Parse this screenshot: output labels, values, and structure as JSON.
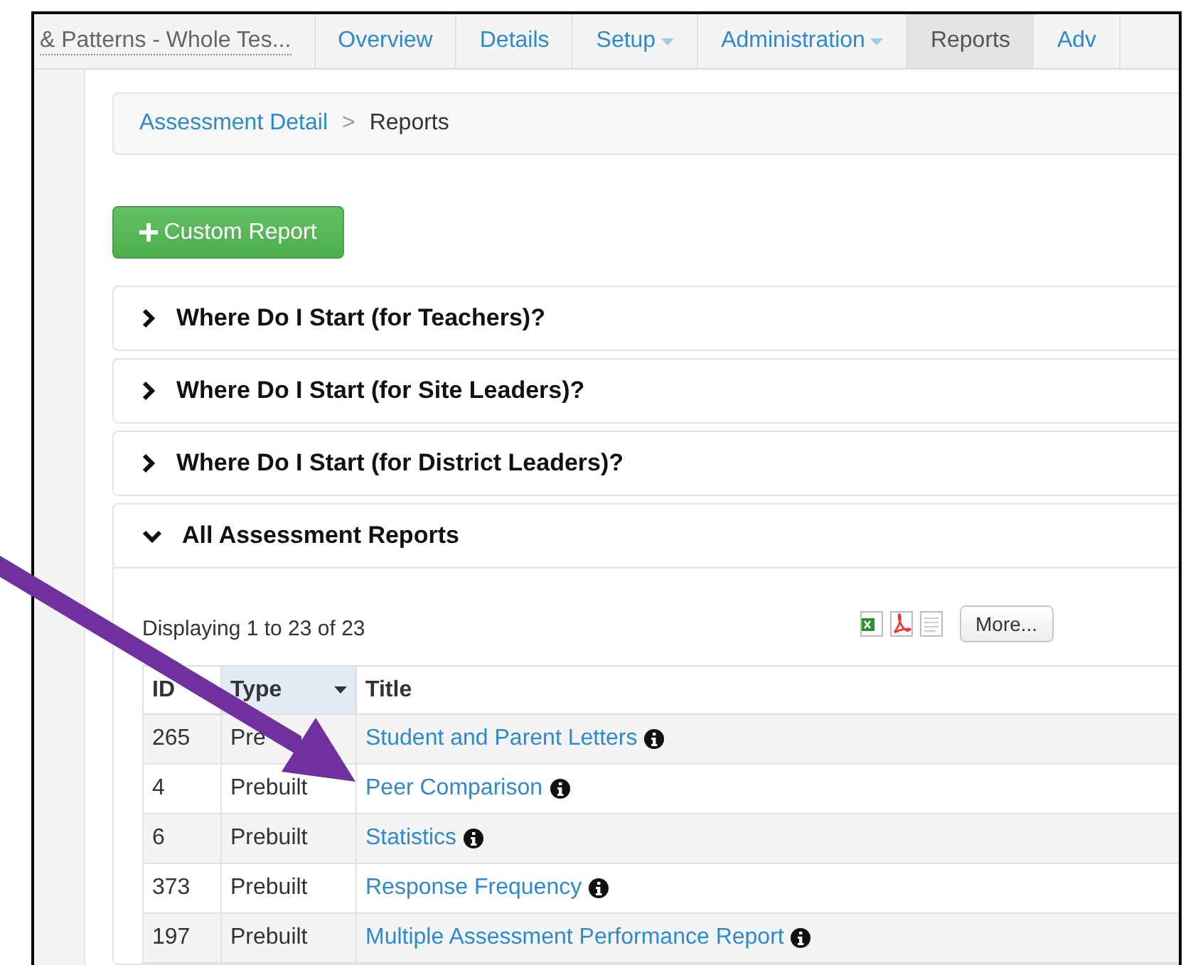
{
  "nav": {
    "items": [
      {
        "label": "& Patterns - Whole Tes...",
        "kind": "title",
        "selected": false
      },
      {
        "label": "Overview",
        "kind": "link",
        "selected": false
      },
      {
        "label": "Details",
        "kind": "link",
        "selected": false
      },
      {
        "label": "Setup",
        "kind": "dropdown",
        "selected": false
      },
      {
        "label": "Administration",
        "kind": "dropdown",
        "selected": false
      },
      {
        "label": "Reports",
        "kind": "link",
        "selected": true
      },
      {
        "label": "Adv",
        "kind": "link",
        "selected": false
      }
    ]
  },
  "breadcrumb": {
    "link": "Assessment Detail",
    "separator": ">",
    "current": "Reports"
  },
  "custom_report_button": "Custom Report",
  "panels": [
    {
      "title": "Where Do I Start (for Teachers)?",
      "expanded": false
    },
    {
      "title": "Where Do I Start (for Site Leaders)?",
      "expanded": false
    },
    {
      "title": "Where Do I Start (for District Leaders)?",
      "expanded": false
    },
    {
      "title": "All Assessment Reports",
      "expanded": true
    }
  ],
  "reports": {
    "summary": "Displaying 1 to 23 of 23",
    "more_button": "More...",
    "columns": [
      {
        "label": "ID",
        "sorted": false
      },
      {
        "label": "Type",
        "sorted": true
      },
      {
        "label": "Title",
        "sorted": false
      }
    ],
    "rows": [
      {
        "id": "265",
        "type": "Pre",
        "title": "Student and Parent Letters"
      },
      {
        "id": "4",
        "type": "Prebuilt",
        "title": "Peer Comparison"
      },
      {
        "id": "6",
        "type": "Prebuilt",
        "title": "Statistics"
      },
      {
        "id": "373",
        "type": "Prebuilt",
        "title": "Response Frequency"
      },
      {
        "id": "197",
        "type": "Prebuilt",
        "title": "Multiple Assessment Performance Report"
      }
    ]
  }
}
